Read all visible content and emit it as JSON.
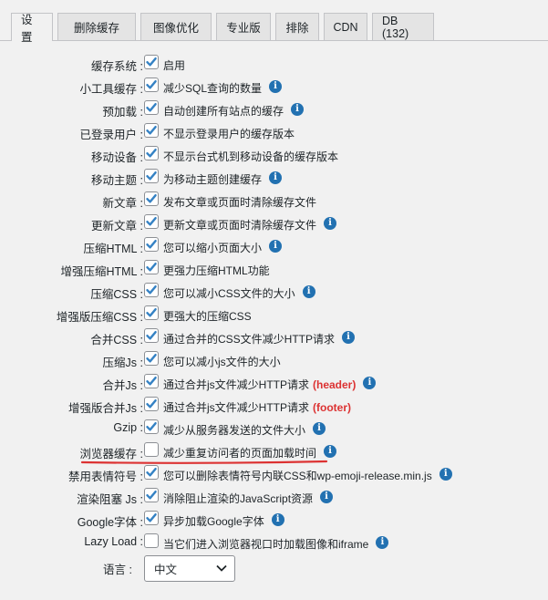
{
  "tabs": [
    {
      "label": "设置",
      "active": true
    },
    {
      "label": "删除缓存"
    },
    {
      "label": "图像优化"
    },
    {
      "label": "专业版"
    },
    {
      "label": "排除"
    },
    {
      "label": "CDN"
    },
    {
      "label": "DB (132)"
    }
  ],
  "settings": [
    {
      "label": "缓存系统 :",
      "desc": "启用",
      "checked": true,
      "info": false
    },
    {
      "label": "小工具缓存 :",
      "desc": "减少SQL查询的数量",
      "checked": true,
      "info": true
    },
    {
      "label": "预加载 :",
      "desc": "自动创建所有站点的缓存",
      "checked": true,
      "info": true
    },
    {
      "label": "已登录用户 :",
      "desc": "不显示登录用户的缓存版本",
      "checked": true,
      "info": false
    },
    {
      "label": "移动设备 :",
      "desc": "不显示台式机到移动设备的缓存版本",
      "checked": true,
      "info": false
    },
    {
      "label": "移动主题 :",
      "desc": "为移动主题创建缓存",
      "checked": true,
      "info": true
    },
    {
      "label": "新文章 :",
      "desc": "发布文章或页面时清除缓存文件",
      "checked": true,
      "info": false
    },
    {
      "label": "更新文章 :",
      "desc": "更新文章或页面时清除缓存文件",
      "checked": true,
      "info": true
    },
    {
      "label": "压缩HTML :",
      "desc": "您可以缩小页面大小",
      "checked": true,
      "info": true
    },
    {
      "label": "增强压缩HTML :",
      "desc": "更强力压缩HTML功能",
      "checked": true,
      "info": false
    },
    {
      "label": "压缩CSS :",
      "desc": "您可以减小CSS文件的大小",
      "checked": true,
      "info": true
    },
    {
      "label": "增强版压缩CSS :",
      "desc": "更强大的压缩CSS",
      "checked": true,
      "info": false
    },
    {
      "label": "合并CSS :",
      "desc": "通过合并的CSS文件减少HTTP请求",
      "checked": true,
      "info": true
    },
    {
      "label": "压缩Js :",
      "desc": "您可以减小js文件的大小",
      "checked": true,
      "info": false
    },
    {
      "label": "合并Js :",
      "desc": "通过合并js文件减少HTTP请求",
      "extra": "(header)",
      "checked": true,
      "info": true
    },
    {
      "label": "增强版合并Js :",
      "desc": "通过合并js文件减少HTTP请求",
      "extra": "(footer)",
      "checked": true,
      "info": false
    },
    {
      "label": "Gzip :",
      "desc": "减少从服务器发送的文件大小",
      "checked": true,
      "info": true
    },
    {
      "label": "浏览器缓存 :",
      "desc": "减少重复访问者的页面加载时间",
      "checked": false,
      "info": true
    },
    {
      "label": "禁用表情符号 :",
      "desc": "您可以删除表情符号内联CSS和wp-emoji-release.min.js",
      "checked": true,
      "info": true
    },
    {
      "label": "渲染阻塞 Js :",
      "desc": "消除阻止渲染的JavaScript资源",
      "checked": true,
      "info": true
    },
    {
      "label": "Google字体 :",
      "desc": "异步加载Google字体",
      "checked": true,
      "info": true
    },
    {
      "label": "Lazy Load :",
      "desc": "当它们进入浏览器视口时加载图像和iframe",
      "checked": false,
      "info": true
    }
  ],
  "language": {
    "label": "语言 :",
    "selected": "中文"
  },
  "colors": {
    "accent": "#2271b1",
    "annotation": "#dc3232",
    "checkmark": "#3582c4"
  },
  "icons": {
    "info": "info-icon",
    "check": "check-icon",
    "dropdown": "chevron-down-icon"
  }
}
